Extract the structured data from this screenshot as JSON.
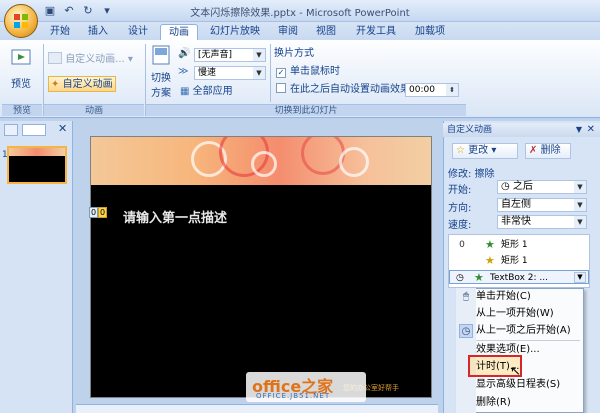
{
  "window": {
    "title": "文本闪烁擦除效果.pptx - Microsoft PowerPoint"
  },
  "quick_access": {
    "icons": [
      "save-icon",
      "undo-icon",
      "redo-icon",
      "quick-access-dropdown-icon"
    ]
  },
  "ribbon_tabs": [
    "开始",
    "插入",
    "设计",
    "动画",
    "幻灯片放映",
    "审阅",
    "视图",
    "开发工具",
    "加载项"
  ],
  "active_tab": "动画",
  "ribbon": {
    "preview_group": {
      "label": "预览",
      "preview_button": "预览"
    },
    "animation_group": {
      "label": "动画",
      "animate_combo": "自定义动画...",
      "custom_animation_button": "自定义动画"
    },
    "transition_group": {
      "label": "切换到此幻灯片",
      "transition_scheme_button": [
        "切换",
        "方案"
      ],
      "sound_combo": "[无声音]",
      "speed_combo": "慢速",
      "apply_all": "全部应用",
      "advance_heading": "换片方式",
      "on_click": "单击鼠标时",
      "on_click_checked": true,
      "auto_after": "在此之后自动设置动画效果:",
      "auto_after_checked": false,
      "auto_time": "00:00"
    }
  },
  "slide": {
    "text": "请输入第一点描述",
    "anim_tag": "0"
  },
  "watermark": {
    "main": "office之家",
    "sub": "OFFICE.JB51.NET",
    "slide_corner": "您的办公室好帮手"
  },
  "custom_animation_pane": {
    "title": "自定义动画",
    "change_button": "更改",
    "remove_button": "删除",
    "modify_heading": "修改: 擦除",
    "start_label": "开始:",
    "start_value": "之后",
    "direction_label": "方向:",
    "direction_value": "自左侧",
    "speed_label": "速度:",
    "speed_value": "非常快",
    "items": [
      {
        "num": "0",
        "name": "矩形 1"
      },
      {
        "num": "",
        "name": "矩形 1"
      },
      {
        "num": "",
        "name": "TextBox 2: ..."
      }
    ]
  },
  "context_menu": {
    "items": [
      "单击开始(C)",
      "从上一项开始(W)",
      "从上一项之后开始(A)",
      "效果选项(E)...",
      "计时(T)...",
      "显示高级日程表(S)",
      "删除(R)"
    ]
  },
  "colors": {
    "ribbon_bg": "#dae6f6",
    "accent": "#15428b",
    "highlight_border": "#d6262a",
    "slide_bg": "#000000"
  }
}
